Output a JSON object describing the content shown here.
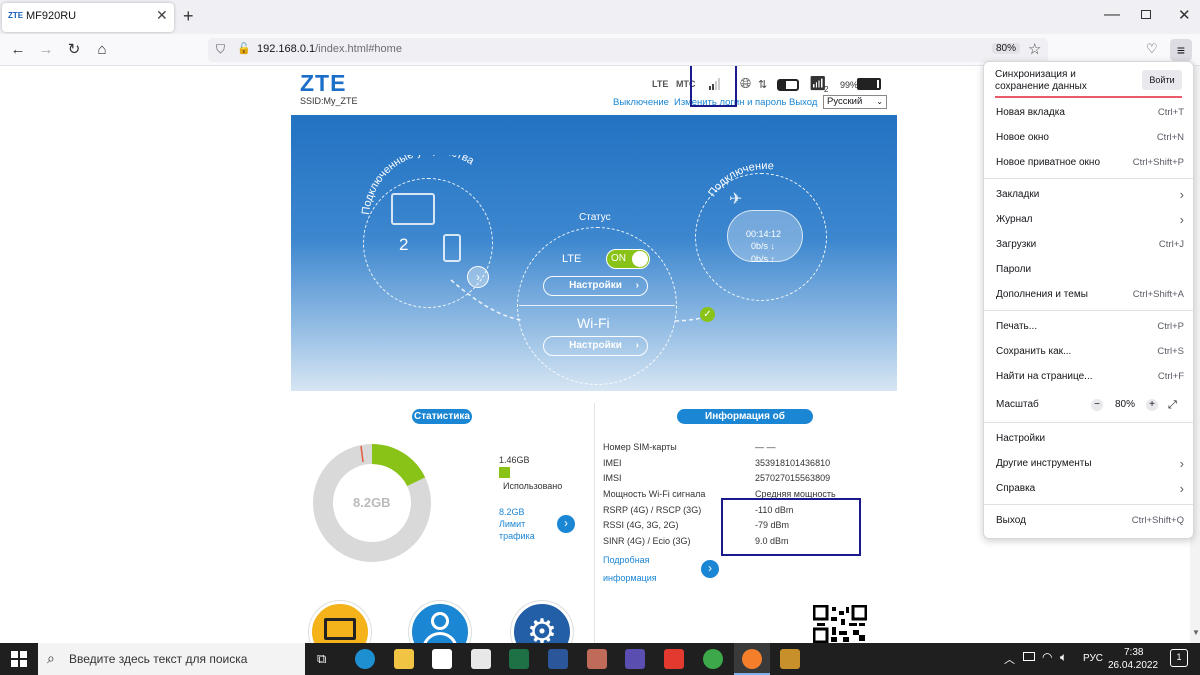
{
  "browser": {
    "tab_title": "MF920RU",
    "tab_favicon": "ZTE",
    "url_host": "192.168.0.1",
    "url_path": "/index.html#home",
    "zoom": "80%"
  },
  "header": {
    "logo": "ZTE",
    "ssid": "SSID:My_ZTE",
    "network_type": "LTE",
    "operator": "МТС",
    "battery": "99%",
    "wifi_clients": "2",
    "links": {
      "shutdown": "Выключение",
      "change_login": "Изменить логин и пароль",
      "logout": "Выход"
    },
    "language": "Русский"
  },
  "hero": {
    "devices_title": "Подключенные устройства",
    "devices_count": "2",
    "status_title": "Статус",
    "lte_label": "LTE",
    "toggle": "ON",
    "settings_1": "Настройки",
    "wifi_label": "Wi-Fi",
    "settings_2": "Настройки",
    "connection_title": "Подключение",
    "conn_time": "00:14:12",
    "down": "0b/s ↓",
    "up": "0b/s ↑"
  },
  "stats": {
    "title": "Статистика",
    "total": "8.2GB",
    "used_amount": "1.46GB",
    "used_label": "Использовано",
    "limit_value": "8.2GB",
    "limit_label1": "Лимит",
    "limit_label2": "трафика",
    "used_fraction": 0.178,
    "colors": {
      "used": "#8ac317",
      "remaining": "#d9d9d9",
      "marker": "#e45b3c"
    }
  },
  "device_info": {
    "title": "Информация об устройстве",
    "rows": [
      {
        "label": "Номер SIM-карты",
        "value": "— —"
      },
      {
        "label": "IMEI",
        "value": "353918101436810"
      },
      {
        "label": "IMSI",
        "value": "257027015563809"
      },
      {
        "label": "Мощность Wi-Fi сигнала",
        "value": "Средняя мощность"
      },
      {
        "label": "RSRP (4G) / RSCP (3G)",
        "value": "-110 dBm"
      },
      {
        "label": "RSSI (4G, 3G, 2G)",
        "value": "-79 dBm"
      },
      {
        "label": "SINR (4G) / Ecio (3G)",
        "value": "9.0 dBm"
      }
    ],
    "more_1": "Подробная",
    "more_2": "информация"
  },
  "menu": {
    "sync_1": "Синхронизация и",
    "sync_2": "сохранение данных",
    "login": "Войти",
    "items": [
      {
        "label": "Новая вкладка",
        "shortcut": "Ctrl+T"
      },
      {
        "label": "Новое окно",
        "shortcut": "Ctrl+N"
      },
      {
        "label": "Новое приватное окно",
        "shortcut": "Ctrl+Shift+P"
      },
      {
        "label": "Закладки",
        "shortcut": ""
      },
      {
        "label": "Журнал",
        "shortcut": ""
      },
      {
        "label": "Загрузки",
        "shortcut": "Ctrl+J"
      },
      {
        "label": "Пароли",
        "shortcut": ""
      },
      {
        "label": "Дополнения и темы",
        "shortcut": "Ctrl+Shift+A"
      },
      {
        "label": "Печать...",
        "shortcut": "Ctrl+P"
      },
      {
        "label": "Сохранить как...",
        "shortcut": "Ctrl+S"
      },
      {
        "label": "Найти на странице...",
        "shortcut": "Ctrl+F"
      },
      {
        "label": "Масштаб",
        "shortcut": ""
      },
      {
        "label": "Настройки",
        "shortcut": ""
      },
      {
        "label": "Другие инструменты",
        "shortcut": ""
      },
      {
        "label": "Справка",
        "shortcut": ""
      },
      {
        "label": "Выход",
        "shortcut": "Ctrl+Shift+Q"
      }
    ],
    "zoom_minus": "−",
    "zoom_value": "80%",
    "zoom_plus": "+"
  },
  "taskbar": {
    "search_placeholder": "Введите здесь текст для поиска",
    "lang": "РУС",
    "time": "7:38",
    "date": "26.04.2022",
    "notifications": "1"
  }
}
